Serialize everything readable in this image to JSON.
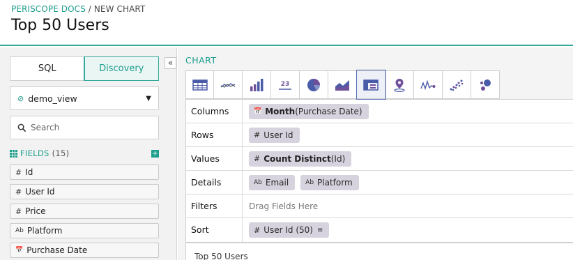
{
  "breadcrumb": {
    "home": "PERISCOPE DOCS",
    "separator": "/",
    "current": "NEW CHART"
  },
  "page_title": "Top 50 Users",
  "left_panel": {
    "tabs": [
      {
        "label": "SQL",
        "active": false
      },
      {
        "label": "Discovery",
        "active": true
      }
    ],
    "dataset": {
      "value": "demo_view"
    },
    "search": {
      "placeholder": "Search",
      "value": ""
    },
    "fields_header": {
      "label": "FIELDS",
      "count": "(15)"
    },
    "fields": [
      {
        "type_icon": "#",
        "label": "Id"
      },
      {
        "type_icon": "#",
        "label": "User Id"
      },
      {
        "type_icon": "#",
        "label": "Price"
      },
      {
        "type_icon": "Ab",
        "label": "Platform"
      },
      {
        "type_icon": "calendar",
        "label": "Purchase Date"
      }
    ],
    "collapse_glyph": "«"
  },
  "chart_panel": {
    "label": "CHART",
    "chart_types": [
      {
        "name": "table-icon"
      },
      {
        "name": "line-icon"
      },
      {
        "name": "bar-chart-icon"
      },
      {
        "name": "number-icon",
        "text": "23"
      },
      {
        "name": "pie-chart-icon"
      },
      {
        "name": "area-chart-icon"
      },
      {
        "name": "pivot-table-icon",
        "active": true
      },
      {
        "name": "map-pin-icon"
      },
      {
        "name": "sparkline-icon"
      },
      {
        "name": "scatter-icon"
      },
      {
        "name": "bubble-icon"
      }
    ],
    "rows": [
      {
        "label": "Columns",
        "pills": [
          {
            "icon": "calendar",
            "bold": "Month",
            "rest": "(Purchase Date)"
          }
        ]
      },
      {
        "label": "Rows",
        "pills": [
          {
            "icon": "#",
            "bold": "",
            "rest": "User Id"
          }
        ]
      },
      {
        "label": "Values",
        "pills": [
          {
            "icon": "#",
            "bold": "Count Distinct",
            "rest": "(Id)"
          }
        ]
      },
      {
        "label": "Details",
        "pills": [
          {
            "icon": "Ab",
            "bold": "",
            "rest": "Email"
          },
          {
            "icon": "Ab",
            "bold": "",
            "rest": "Platform"
          }
        ]
      },
      {
        "label": "Filters",
        "placeholder": "Drag Fields Here"
      },
      {
        "label": "Sort",
        "pills": [
          {
            "icon": "#",
            "bold": "",
            "rest": "User Id (50)",
            "sort": "≡"
          }
        ]
      }
    ],
    "preview_title": "Top 50 Users"
  },
  "colors": {
    "accent": "#1e9e8d",
    "pill": "#d6d2de",
    "active_chart": "#5b6fb5"
  }
}
